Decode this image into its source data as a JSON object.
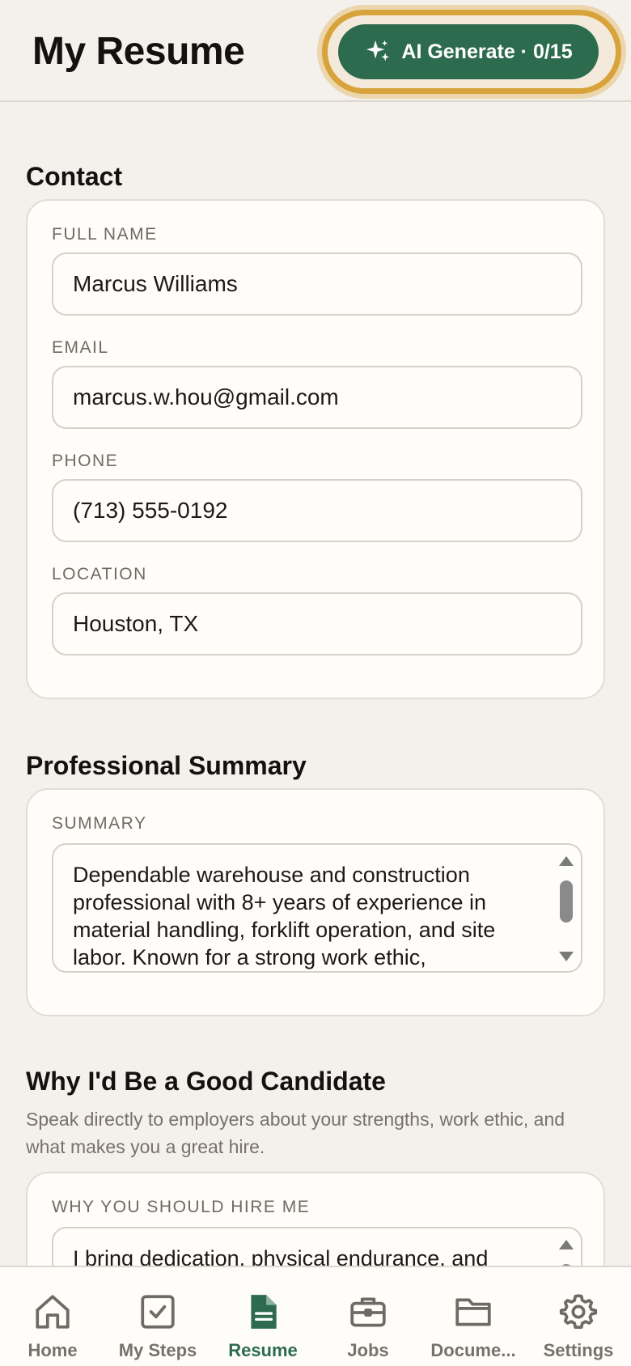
{
  "header": {
    "title": "My Resume",
    "ai_button_label": "AI Generate · 0/15"
  },
  "contact": {
    "section_title": "Contact",
    "fields": [
      {
        "label": "FULL NAME",
        "value": "Marcus Williams"
      },
      {
        "label": "EMAIL",
        "value": "marcus.w.hou@gmail.com"
      },
      {
        "label": "PHONE",
        "value": "(713) 555-0192"
      },
      {
        "label": "LOCATION",
        "value": "Houston, TX"
      }
    ]
  },
  "summary": {
    "section_title": "Professional Summary",
    "label": "SUMMARY",
    "value": "Dependable warehouse and construction professional with 8+ years of experience in material handling, forklift operation, and site labor. Known for a strong work ethic,"
  },
  "candidate": {
    "section_title": "Why I'd Be a Good Candidate",
    "description": "Speak directly to employers about your strengths, work ethic, and what makes you a great hire.",
    "label": "WHY YOU SHOULD HIRE ME",
    "value": "I bring dedication, physical endurance, and"
  },
  "tabs": [
    {
      "label": "Home",
      "icon": "home-icon"
    },
    {
      "label": "My Steps",
      "icon": "checkbox-icon"
    },
    {
      "label": "Resume",
      "icon": "document-icon",
      "active": true
    },
    {
      "label": "Jobs",
      "icon": "briefcase-icon"
    },
    {
      "label": "Docume...",
      "icon": "folder-icon"
    },
    {
      "label": "Settings",
      "icon": "gear-icon"
    }
  ],
  "colors": {
    "accent": "#2d6b4f",
    "highlight_ring": "#d9a33c",
    "background": "#f4f1ec"
  }
}
